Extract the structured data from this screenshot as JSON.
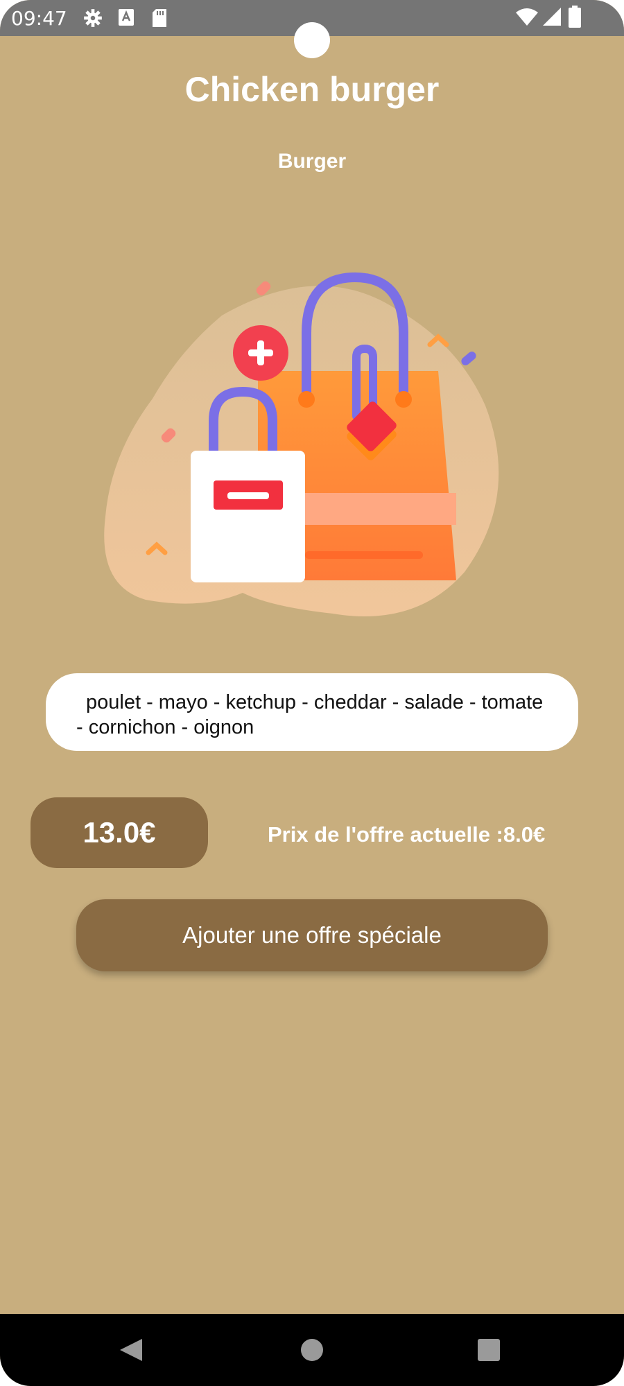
{
  "status_bar": {
    "time": "09:47",
    "icons": [
      "gear-icon",
      "a-square-icon",
      "sd-card-icon",
      "wifi-icon",
      "signal-icon",
      "battery-icon"
    ]
  },
  "product": {
    "title": "Chicken burger",
    "category": "Burger",
    "illustration": "shopping-bags-illustration",
    "ingredients": "poulet - mayo - ketchup - cheddar - salade - tomate - cornichon - oignon",
    "price": "13.0€",
    "offer_label": "Prix de l'offre actuelle :",
    "offer_value": "8.0€"
  },
  "actions": {
    "add_offer_label": "Ajouter une offre spéciale"
  },
  "nav_bar": {
    "icons": [
      "back-icon",
      "home-icon",
      "recents-icon"
    ]
  },
  "colors": {
    "background": "#c8ae7e",
    "accent_brown": "#8a6b43",
    "status_bar": "#757575",
    "text_on_bg": "#ffffff"
  }
}
